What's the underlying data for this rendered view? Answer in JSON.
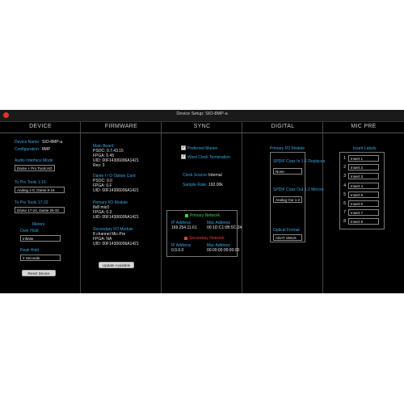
{
  "window": {
    "title": "Device Setup: SIO-8MP-a"
  },
  "columns": [
    "DEVICE",
    "FIRMWARE",
    "SYNC",
    "DIGITAL",
    "MIC PRE"
  ],
  "device": {
    "name_label": "Device Name:",
    "name_value": "SIO-8MP-a",
    "config_label": "Configuration:",
    "config_value": "8MP",
    "aim_label": "Audio Interface Mode",
    "aim_value": "Dante + Pro Tools HD",
    "to1_label": "To Pro Tools 1-16",
    "to1_value": "Analog 1-8, Dante 9-16",
    "to2_label": "To Pro Tools 17-32",
    "to2_value": "Dante 17-24, Dante 25-32",
    "meters_label": "Meters",
    "over_label": "Over Hold",
    "over_value": "Infinite",
    "peak_label": "Peak Hold",
    "peak_value": "2 Seconds",
    "reset_button": "Reset Device"
  },
  "firmware": {
    "main_title": "Main Board",
    "main_lines": [
      "PSOC: 0.7.43.15",
      "FPGA: 0.45",
      "UID: 00F14306006A1421",
      "Rev: 3"
    ],
    "dante_title": "Dante I / O Option Card",
    "dante_lines": [
      "PSOC: 0.0",
      "FPGA: 0.F",
      "UID: 00F14306006A1421"
    ],
    "primary_title": "Primary I/O Module",
    "primary_lines": [
      "8x8 mic0",
      "FPGA: 0.3",
      "UID: 00F14306006A1421"
    ],
    "secondary_title": "Secondary I/O Module",
    "secondary_lines": [
      "8 channel Mic-Pre",
      "FPGA: NA",
      "UID: 00F14306006A1421"
    ],
    "update_button": "Update Available"
  },
  "sync": {
    "preferred_master": "Preferred Master",
    "word_clock": "Word Clock Termination",
    "clock_source_label": "Clock Source:",
    "clock_source_value": "Internal",
    "sample_rate_label": "Sample Rate:",
    "sample_rate_value": "192.00k",
    "primary_net_title": "Primary Network",
    "secondary_net_title": "Secondary Network",
    "ip_label": "IP Address",
    "mac_label": "Mac Address",
    "primary_ip": "169.254.11.61",
    "primary_mac": "00:1D:C1:0B:5C:34",
    "secondary_ip": "0.0.0.0",
    "secondary_mac": "00:00:00:00:00:00",
    "check_mark": "✓",
    "colors": {
      "primary": "#3ad13a",
      "secondary": "#e04030"
    }
  },
  "digital": {
    "module_title": "Primary I/O Module",
    "spdif_in_label": "SPDIF Coax In 1-2 Replaces",
    "spdif_in_value": "None",
    "spdif_out_label": "SPDIF Coax Out 1-2 Mirrors",
    "spdif_out_value": "Analog Out 1-2",
    "optical_label": "Optical Format",
    "optical_value": "ADAT SMUX"
  },
  "micpre": {
    "title": "Insert Labels",
    "inserts": [
      {
        "num": "1",
        "label": "Insert 1"
      },
      {
        "num": "2",
        "label": "Insert 2"
      },
      {
        "num": "3",
        "label": "Insert 3"
      },
      {
        "num": "4",
        "label": "Insert 4"
      },
      {
        "num": "5",
        "label": "Insert 5"
      },
      {
        "num": "6",
        "label": "Insert 6"
      },
      {
        "num": "7",
        "label": "Insert 7"
      },
      {
        "num": "8",
        "label": "Insert 8"
      }
    ]
  }
}
